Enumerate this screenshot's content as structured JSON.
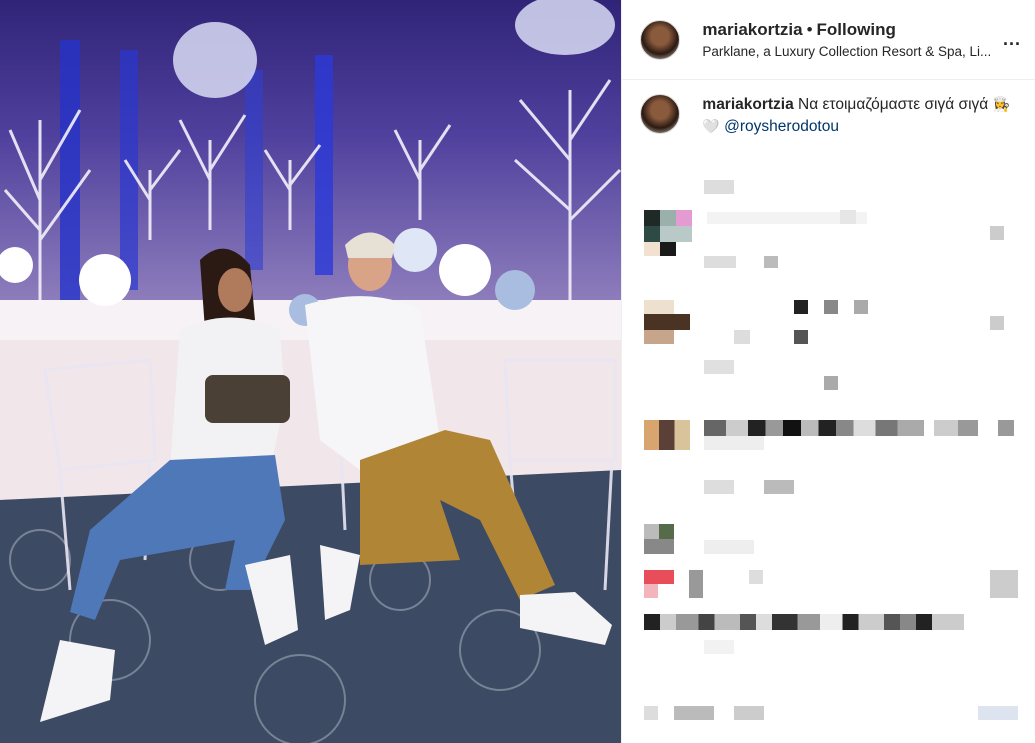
{
  "post": {
    "username": "mariakortzia",
    "separator": "•",
    "follow_status": "Following",
    "location": "Parklane, a Luxury Collection Resort & Spa, Li...",
    "more_label": "...",
    "caption": {
      "username": "mariakortzia",
      "text": "Να ετοιμαζόμαστε σιγά σιγά",
      "emojis": "👩‍🍳🤍",
      "mention": "@roysherodotou"
    }
  },
  "colors": {
    "link": "#00376b",
    "text": "#262626",
    "border": "#efefef"
  }
}
